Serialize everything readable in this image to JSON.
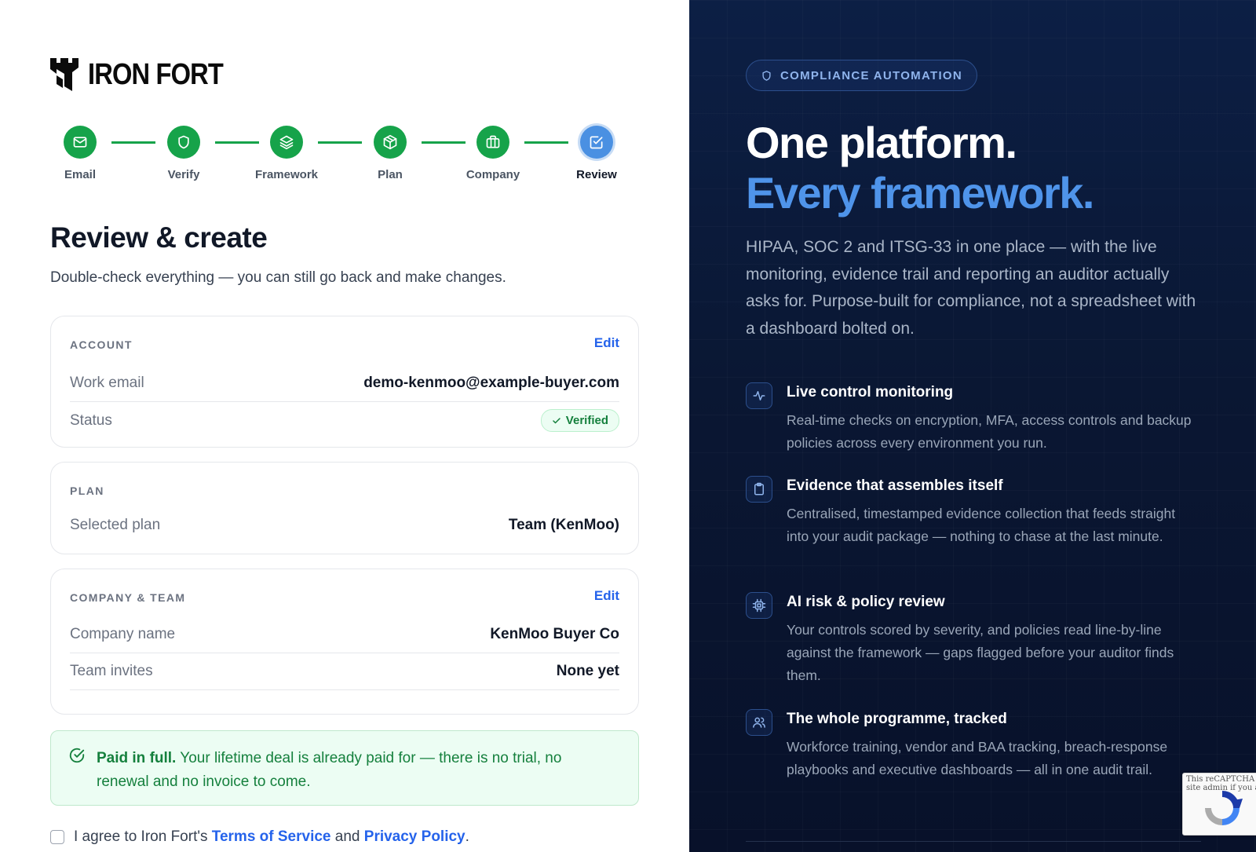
{
  "brand": {
    "name": "IRON FORT"
  },
  "steps": [
    {
      "label": "Email",
      "icon": "mail-icon",
      "state": "done"
    },
    {
      "label": "Verify",
      "icon": "shield-icon",
      "state": "done"
    },
    {
      "label": "Framework",
      "icon": "layers-icon",
      "state": "done"
    },
    {
      "label": "Plan",
      "icon": "package-icon",
      "state": "done"
    },
    {
      "label": "Company",
      "icon": "briefcase-icon",
      "state": "done"
    },
    {
      "label": "Review",
      "icon": "check-square-icon",
      "state": "active"
    }
  ],
  "page": {
    "title": "Review & create",
    "subtitle": "Double-check everything — you can still go back and make changes."
  },
  "account": {
    "heading": "ACCOUNT",
    "edit_label": "Edit",
    "email_label": "Work email",
    "email_value": "demo-kenmoo@example-buyer.com",
    "status_label": "Status",
    "status_value": "Verified"
  },
  "plan": {
    "heading": "PLAN",
    "selected_label": "Selected plan",
    "selected_value": "Team (KenMoo)"
  },
  "company": {
    "heading": "COMPANY & TEAM",
    "edit_label": "Edit",
    "name_label": "Company name",
    "name_value": "KenMoo Buyer Co",
    "invites_label": "Team invites",
    "invites_value": "None yet"
  },
  "notice": {
    "strong": "Paid in full.",
    "text": " Your lifetime deal is already paid for — there is no trial, no renewal and no invoice to come."
  },
  "agree": {
    "prefix": "I agree to Iron Fort's ",
    "terms": "Terms of Service",
    "and": " and ",
    "privacy": "Privacy Policy",
    "suffix": "."
  },
  "marketing": {
    "pill": "COMPLIANCE AUTOMATION",
    "hero_line1": "One platform.",
    "hero_line2": "Every framework.",
    "lead": "HIPAA, SOC 2 and ITSG-33 in one place — with the live monitoring, evidence trail and reporting an auditor actually asks for. Purpose-built for compliance, not a spreadsheet with a dashboard bolted on.",
    "features": [
      {
        "icon": "activity-icon",
        "title": "Live control monitoring",
        "desc": "Real-time checks on encryption, MFA, access controls and backup policies across every environment you run."
      },
      {
        "icon": "clipboard-icon",
        "title": "Evidence that assembles itself",
        "desc": "Centralised, timestamped evidence collection that feeds straight into your audit package — nothing to chase at the last minute."
      },
      {
        "icon": "cpu-icon",
        "title": "AI risk & policy review",
        "desc": "Your controls scored by severity, and policies read line-by-line against the framework — gaps flagged before your auditor finds them."
      },
      {
        "icon": "users-icon",
        "title": "The whole programme, tracked",
        "desc": "Workforce training, vendor and BAA tracking, breach-response playbooks and executive dashboards — all in one audit trail."
      }
    ]
  },
  "recaptcha": {
    "text_line1": "This reCAPTCHA",
    "text_line2": "site admin if you are"
  },
  "colors": {
    "success": "#16a34a",
    "active_step": "#4a90e2",
    "link": "#2563eb",
    "panel_bg": "#0a1733",
    "accent": "#4f94ea"
  }
}
